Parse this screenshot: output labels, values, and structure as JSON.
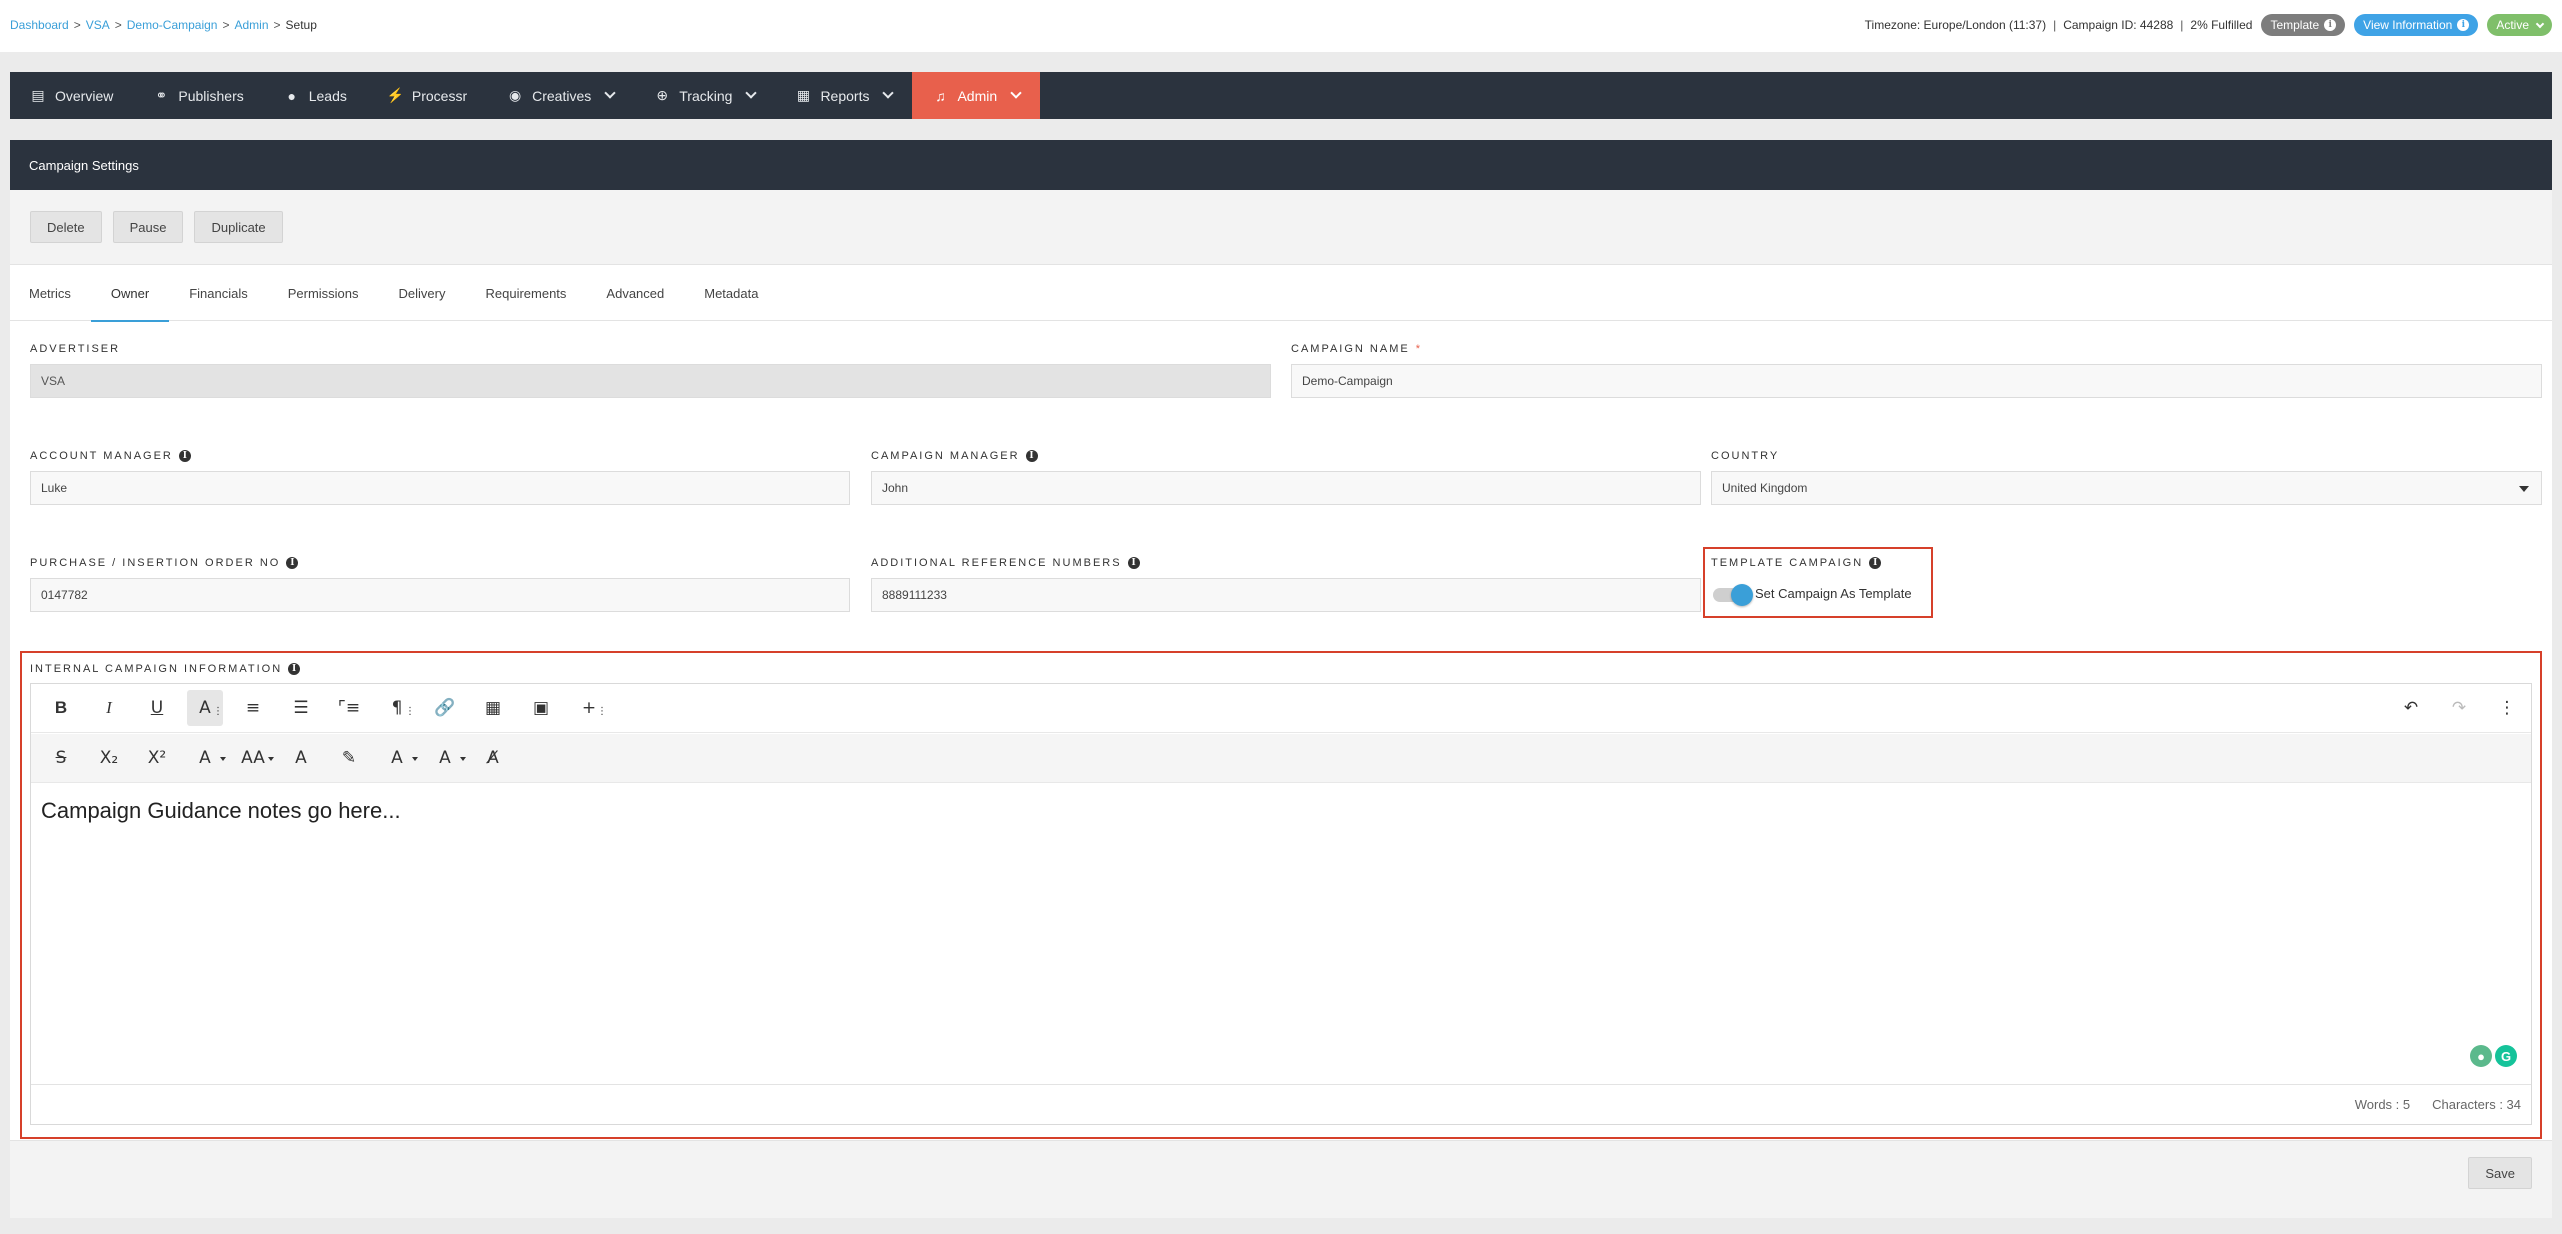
{
  "breadcrumb": {
    "items": [
      "Dashboard",
      "VSA",
      "Demo-Campaign",
      "Admin"
    ],
    "current": "Setup"
  },
  "header": {
    "timezone": "Timezone: Europe/London (11:37)",
    "campaign_id": "Campaign ID: 44288",
    "fulfilled": "2% Fulfilled",
    "template_pill": "Template",
    "view_info_pill": "View Information",
    "status_pill": "Active",
    "colors": {
      "template": "#7d7d7d",
      "view_info": "#3fa3e6",
      "active": "#7fbf6a"
    }
  },
  "nav": {
    "items": [
      {
        "label": "Overview",
        "icon": "overview-icon"
      },
      {
        "label": "Publishers",
        "icon": "publishers-icon"
      },
      {
        "label": "Leads",
        "icon": "user-icon"
      },
      {
        "label": "Processr",
        "icon": "bolt-icon"
      },
      {
        "label": "Creatives",
        "icon": "palette-icon"
      },
      {
        "label": "Tracking",
        "icon": "crosshair-icon"
      },
      {
        "label": "Reports",
        "icon": "report-icon"
      },
      {
        "label": "Admin",
        "icon": "guitar-icon"
      }
    ],
    "active": "Admin",
    "active_color": "#e8604c"
  },
  "panel": {
    "title": "Campaign Settings",
    "actions": [
      "Delete",
      "Pause",
      "Duplicate"
    ],
    "tabs": [
      "Metrics",
      "Owner",
      "Financials",
      "Permissions",
      "Delivery",
      "Requirements",
      "Advanced",
      "Metadata"
    ],
    "active_tab": "Owner"
  },
  "form": {
    "advertiser": {
      "label": "Advertiser",
      "value": "VSA"
    },
    "campaign_name": {
      "label": "Campaign Name",
      "required_mark": "*",
      "value": "Demo-Campaign"
    },
    "account_manager": {
      "label": "Account Manager",
      "value": "Luke"
    },
    "campaign_manager": {
      "label": "Campaign Manager",
      "value": "John"
    },
    "country": {
      "label": "Country",
      "value": "United Kingdom"
    },
    "purchase_order": {
      "label": "Purchase / Insertion Order No",
      "value": "0147782"
    },
    "additional_refs": {
      "label": "Additional Reference Numbers",
      "value": "8889111233"
    },
    "template_campaign": {
      "label": "Template Campaign",
      "toggle_label": "Set Campaign As Template",
      "enabled": true
    },
    "internal_info": {
      "label": "Internal Campaign Information"
    }
  },
  "editor": {
    "content": "Campaign Guidance notes go here...",
    "words": "Words : 5",
    "characters": "Characters : 34"
  },
  "footer": {
    "save_label": "Save"
  }
}
